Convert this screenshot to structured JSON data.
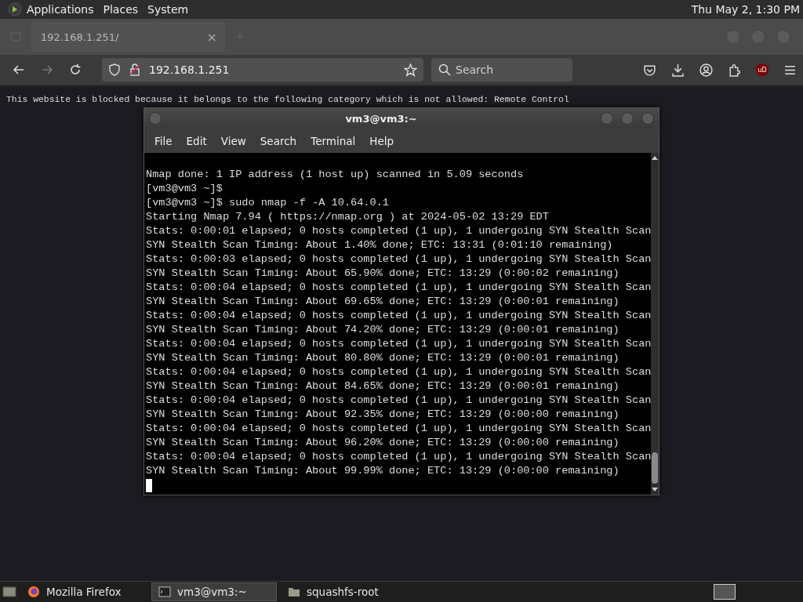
{
  "top_panel": {
    "menus": [
      "Applications",
      "Places",
      "System"
    ],
    "clock": "Thu May  2, 1:30 PM"
  },
  "browser": {
    "tab": {
      "title": "192.168.1.251/",
      "close": "×"
    },
    "address": "192.168.1.251",
    "search": {
      "placeholder": "Search"
    },
    "addon_badge": "uD",
    "message": "This website is blocked because it belongs to the following category which is not allowed: Remote Control"
  },
  "terminal": {
    "title": "vm3@vm3:~",
    "menus": [
      "File",
      "Edit",
      "View",
      "Search",
      "Terminal",
      "Help"
    ],
    "lines": [
      "Nmap done: 1 IP address (1 host up) scanned in 5.09 seconds",
      "[vm3@vm3 ~]$",
      "[vm3@vm3 ~]$ sudo nmap -f -A 10.64.0.1",
      "Starting Nmap 7.94 ( https://nmap.org ) at 2024-05-02 13:29 EDT",
      "Stats: 0:00:01 elapsed; 0 hosts completed (1 up), 1 undergoing SYN Stealth Scan",
      "SYN Stealth Scan Timing: About 1.40% done; ETC: 13:31 (0:01:10 remaining)",
      "Stats: 0:00:03 elapsed; 0 hosts completed (1 up), 1 undergoing SYN Stealth Scan",
      "SYN Stealth Scan Timing: About 65.90% done; ETC: 13:29 (0:00:02 remaining)",
      "Stats: 0:00:04 elapsed; 0 hosts completed (1 up), 1 undergoing SYN Stealth Scan",
      "SYN Stealth Scan Timing: About 69.65% done; ETC: 13:29 (0:00:01 remaining)",
      "Stats: 0:00:04 elapsed; 0 hosts completed (1 up), 1 undergoing SYN Stealth Scan",
      "SYN Stealth Scan Timing: About 74.20% done; ETC: 13:29 (0:00:01 remaining)",
      "Stats: 0:00:04 elapsed; 0 hosts completed (1 up), 1 undergoing SYN Stealth Scan",
      "SYN Stealth Scan Timing: About 80.80% done; ETC: 13:29 (0:00:01 remaining)",
      "Stats: 0:00:04 elapsed; 0 hosts completed (1 up), 1 undergoing SYN Stealth Scan",
      "SYN Stealth Scan Timing: About 84.65% done; ETC: 13:29 (0:00:01 remaining)",
      "Stats: 0:00:04 elapsed; 0 hosts completed (1 up), 1 undergoing SYN Stealth Scan",
      "SYN Stealth Scan Timing: About 92.35% done; ETC: 13:29 (0:00:00 remaining)",
      "Stats: 0:00:04 elapsed; 0 hosts completed (1 up), 1 undergoing SYN Stealth Scan",
      "SYN Stealth Scan Timing: About 96.20% done; ETC: 13:29 (0:00:00 remaining)",
      "Stats: 0:00:04 elapsed; 0 hosts completed (1 up), 1 undergoing SYN Stealth Scan",
      "SYN Stealth Scan Timing: About 99.99% done; ETC: 13:29 (0:00:00 remaining)"
    ]
  },
  "taskbar": {
    "items": [
      {
        "kind": "browser",
        "label": "Mozilla Firefox",
        "selected": false
      },
      {
        "kind": "terminal",
        "label": "vm3@vm3:~",
        "selected": true
      },
      {
        "kind": "folder",
        "label": "squashfs-root",
        "selected": false
      }
    ]
  }
}
